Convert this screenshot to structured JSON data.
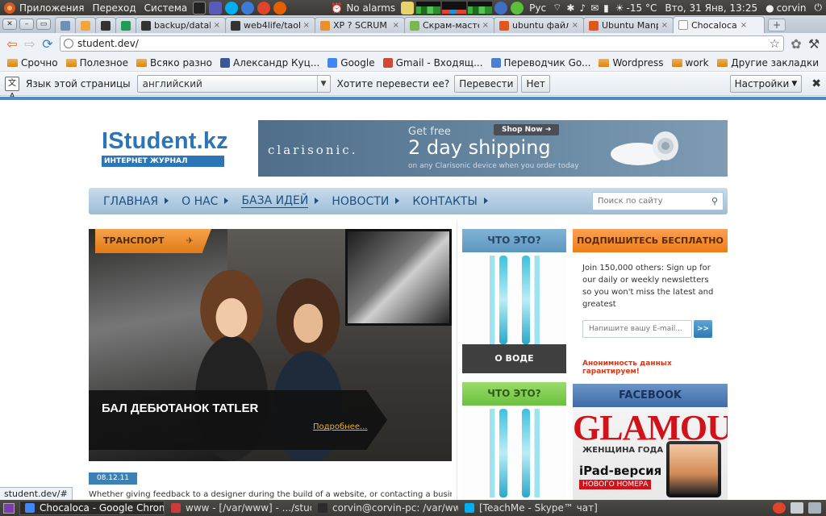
{
  "panel": {
    "menus": [
      "Приложения",
      "Переход",
      "Система"
    ],
    "alarm": "No alarms",
    "layout": "Рус",
    "temperature": "-15 °C",
    "datetime": "Вто, 31 Янв, 13:25",
    "user": "corvin"
  },
  "tabs": [
    {
      "title": "",
      "pinned": true,
      "favicon": "chat-icon",
      "color": "#6f8fb8"
    },
    {
      "title": "",
      "pinned": true,
      "favicon": "pma-icon",
      "color": "#f4a53b"
    },
    {
      "title": "",
      "pinned": true,
      "favicon": "github-icon",
      "color": "#333333"
    },
    {
      "title": "",
      "pinned": true,
      "favicon": "sheet-icon",
      "color": "#1f9d55"
    },
    {
      "title": "backup/databa",
      "favicon": "github-icon",
      "color": "#333333"
    },
    {
      "title": "web4life/taoba",
      "favicon": "github-icon",
      "color": "#333333"
    },
    {
      "title": "XP ? SCRUM - I",
      "favicon": "xp-icon",
      "color": "#e8912b"
    },
    {
      "title": "Скрам-мастер",
      "favicon": "leaf-icon",
      "color": "#78b84d"
    },
    {
      "title": "ubuntu файл",
      "favicon": "ubuntu-icon",
      "color": "#e2561c"
    },
    {
      "title": "Ubuntu Manpa",
      "favicon": "ubuntu-icon",
      "color": "#e2561c"
    },
    {
      "title": "Chocaloca",
      "favicon": "page-icon",
      "color": "#ffffff",
      "active": true
    }
  ],
  "address": "student.dev/",
  "bookmarks": [
    {
      "label": "Срочно",
      "type": "folder"
    },
    {
      "label": "Полезное",
      "type": "folder"
    },
    {
      "label": "Всяко разно",
      "type": "folder"
    },
    {
      "label": "Александр Куц...",
      "type": "link",
      "color": "#3b5998"
    },
    {
      "label": "Google",
      "type": "link",
      "color": "#4285f4"
    },
    {
      "label": "Gmail - Входящ...",
      "type": "link",
      "color": "#d14836"
    },
    {
      "label": "Переводчик Go...",
      "type": "link",
      "color": "#4a7fd6"
    },
    {
      "label": "Wordpress",
      "type": "folder"
    },
    {
      "label": "work",
      "type": "folder"
    }
  ],
  "other_bookmarks": "Другие закладки",
  "translate": {
    "label": "Язык этой страницы",
    "language": "английский",
    "question": "Хотите перевести ее?",
    "translate_btn": "Перевести",
    "no_btn": "Нет",
    "settings_btn": "Настройки"
  },
  "site": {
    "logo": "IStudent.kz",
    "tagline": "ИНТЕРНЕТ ЖУРНАЛ",
    "banner": {
      "brand": "clarisonic.",
      "get_free": "Get free",
      "shop_now": "Shop Now",
      "headline": "2 day shipping",
      "fine_print": "on any Clarisonic device when you order today"
    },
    "nav": [
      "ГЛАВНАЯ",
      "О НАС",
      "БАЗА ИДЕЙ",
      "НОВОСТИ",
      "КОНТАКТЫ"
    ],
    "nav_current": 2,
    "search_placeholder": "Поиск по сайту",
    "feature": {
      "category": "ТРАНСПОРТ",
      "title": "БАЛ ДЕБЮТАНОК TATLER",
      "more": "Подробнее...",
      "date": "08.12.11",
      "excerpt": "Whether giving feedback to a designer during the build of a website, or contacting a business because"
    },
    "what1": {
      "title": "ЧТО ЭТО?",
      "label": "О ВОДЕ"
    },
    "what2": {
      "title": "ЧТО ЭТО?"
    },
    "subscribe": {
      "title": "ПОДПИШИТЕСЬ БЕСПЛАТНО",
      "text": "Join 150,000 others: Sign up for our daily or weekly newsletters so you won't miss the latest and greatest",
      "email_placeholder": "Напишите вашу E-mail...",
      "go": ">>",
      "anon": "Анонимность данных гарантируем!"
    },
    "facebook": {
      "title": "FACEBOOK",
      "mag_title": "GLAMOUR",
      "mag_line1": "ЖЕНЩИНА ГОДА",
      "mag_line2": "iPad-версия",
      "mag_line3": "НОВОГО НОМЕРА"
    }
  },
  "status_url": "student.dev/#",
  "taskbar": [
    {
      "label": "Chocaloca - Google Chrome",
      "active": true,
      "color": "#4285f4"
    },
    {
      "label": "www - [/var/www] - .../stud...",
      "color": "#cc3b3b"
    },
    {
      "label": "corvin@corvin-pc: /var/ww...",
      "color": "#2b2b2b"
    },
    {
      "label": "[TeachMe - Skype™ чат]",
      "color": "#00aff0"
    }
  ]
}
